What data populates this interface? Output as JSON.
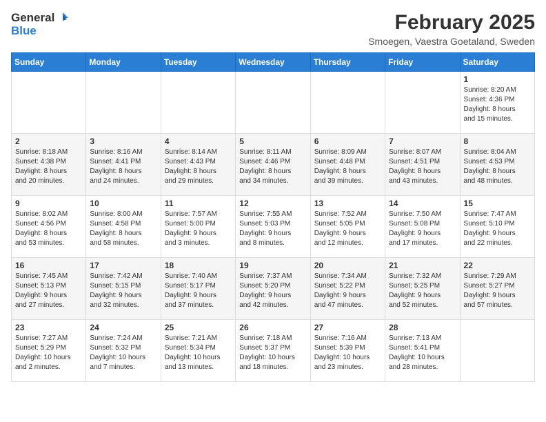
{
  "logo": {
    "general": "General",
    "blue": "Blue"
  },
  "title": "February 2025",
  "subtitle": "Smoegen, Vaestra Goetaland, Sweden",
  "weekdays": [
    "Sunday",
    "Monday",
    "Tuesday",
    "Wednesday",
    "Thursday",
    "Friday",
    "Saturday"
  ],
  "weeks": [
    [
      {
        "day": "",
        "info": ""
      },
      {
        "day": "",
        "info": ""
      },
      {
        "day": "",
        "info": ""
      },
      {
        "day": "",
        "info": ""
      },
      {
        "day": "",
        "info": ""
      },
      {
        "day": "",
        "info": ""
      },
      {
        "day": "1",
        "info": "Sunrise: 8:20 AM\nSunset: 4:36 PM\nDaylight: 8 hours\nand 15 minutes."
      }
    ],
    [
      {
        "day": "2",
        "info": "Sunrise: 8:18 AM\nSunset: 4:38 PM\nDaylight: 8 hours\nand 20 minutes."
      },
      {
        "day": "3",
        "info": "Sunrise: 8:16 AM\nSunset: 4:41 PM\nDaylight: 8 hours\nand 24 minutes."
      },
      {
        "day": "4",
        "info": "Sunrise: 8:14 AM\nSunset: 4:43 PM\nDaylight: 8 hours\nand 29 minutes."
      },
      {
        "day": "5",
        "info": "Sunrise: 8:11 AM\nSunset: 4:46 PM\nDaylight: 8 hours\nand 34 minutes."
      },
      {
        "day": "6",
        "info": "Sunrise: 8:09 AM\nSunset: 4:48 PM\nDaylight: 8 hours\nand 39 minutes."
      },
      {
        "day": "7",
        "info": "Sunrise: 8:07 AM\nSunset: 4:51 PM\nDaylight: 8 hours\nand 43 minutes."
      },
      {
        "day": "8",
        "info": "Sunrise: 8:04 AM\nSunset: 4:53 PM\nDaylight: 8 hours\nand 48 minutes."
      }
    ],
    [
      {
        "day": "9",
        "info": "Sunrise: 8:02 AM\nSunset: 4:56 PM\nDaylight: 8 hours\nand 53 minutes."
      },
      {
        "day": "10",
        "info": "Sunrise: 8:00 AM\nSunset: 4:58 PM\nDaylight: 8 hours\nand 58 minutes."
      },
      {
        "day": "11",
        "info": "Sunrise: 7:57 AM\nSunset: 5:00 PM\nDaylight: 9 hours\nand 3 minutes."
      },
      {
        "day": "12",
        "info": "Sunrise: 7:55 AM\nSunset: 5:03 PM\nDaylight: 9 hours\nand 8 minutes."
      },
      {
        "day": "13",
        "info": "Sunrise: 7:52 AM\nSunset: 5:05 PM\nDaylight: 9 hours\nand 12 minutes."
      },
      {
        "day": "14",
        "info": "Sunrise: 7:50 AM\nSunset: 5:08 PM\nDaylight: 9 hours\nand 17 minutes."
      },
      {
        "day": "15",
        "info": "Sunrise: 7:47 AM\nSunset: 5:10 PM\nDaylight: 9 hours\nand 22 minutes."
      }
    ],
    [
      {
        "day": "16",
        "info": "Sunrise: 7:45 AM\nSunset: 5:13 PM\nDaylight: 9 hours\nand 27 minutes."
      },
      {
        "day": "17",
        "info": "Sunrise: 7:42 AM\nSunset: 5:15 PM\nDaylight: 9 hours\nand 32 minutes."
      },
      {
        "day": "18",
        "info": "Sunrise: 7:40 AM\nSunset: 5:17 PM\nDaylight: 9 hours\nand 37 minutes."
      },
      {
        "day": "19",
        "info": "Sunrise: 7:37 AM\nSunset: 5:20 PM\nDaylight: 9 hours\nand 42 minutes."
      },
      {
        "day": "20",
        "info": "Sunrise: 7:34 AM\nSunset: 5:22 PM\nDaylight: 9 hours\nand 47 minutes."
      },
      {
        "day": "21",
        "info": "Sunrise: 7:32 AM\nSunset: 5:25 PM\nDaylight: 9 hours\nand 52 minutes."
      },
      {
        "day": "22",
        "info": "Sunrise: 7:29 AM\nSunset: 5:27 PM\nDaylight: 9 hours\nand 57 minutes."
      }
    ],
    [
      {
        "day": "23",
        "info": "Sunrise: 7:27 AM\nSunset: 5:29 PM\nDaylight: 10 hours\nand 2 minutes."
      },
      {
        "day": "24",
        "info": "Sunrise: 7:24 AM\nSunset: 5:32 PM\nDaylight: 10 hours\nand 7 minutes."
      },
      {
        "day": "25",
        "info": "Sunrise: 7:21 AM\nSunset: 5:34 PM\nDaylight: 10 hours\nand 13 minutes."
      },
      {
        "day": "26",
        "info": "Sunrise: 7:18 AM\nSunset: 5:37 PM\nDaylight: 10 hours\nand 18 minutes."
      },
      {
        "day": "27",
        "info": "Sunrise: 7:16 AM\nSunset: 5:39 PM\nDaylight: 10 hours\nand 23 minutes."
      },
      {
        "day": "28",
        "info": "Sunrise: 7:13 AM\nSunset: 5:41 PM\nDaylight: 10 hours\nand 28 minutes."
      },
      {
        "day": "",
        "info": ""
      }
    ]
  ]
}
